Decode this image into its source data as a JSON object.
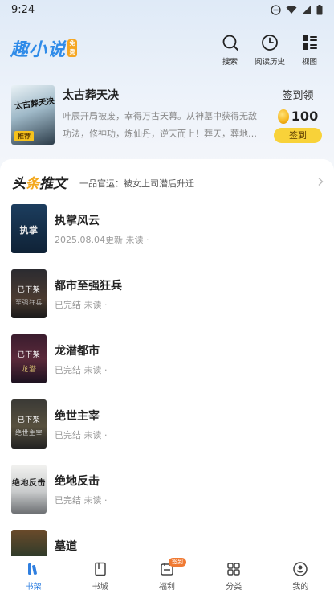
{
  "status_bar": {
    "time": "9:24"
  },
  "header": {
    "logo_text": "趣小说",
    "logo_badge": "免费",
    "actions": [
      {
        "label": "搜索",
        "icon": "search-icon"
      },
      {
        "label": "阅读历史",
        "icon": "clock-icon"
      },
      {
        "label": "视图",
        "icon": "grid-view-icon"
      }
    ]
  },
  "featured": {
    "title": "太古葬天决",
    "cover_title": "太古葬天决",
    "badge": "推荐",
    "description": "叶辰开局被废，幸得万古天幕。从神墓中获得无敌功法，修神功，炼仙丹，逆天而上！葬天，葬地…"
  },
  "signin": {
    "label": "签到领",
    "coins": "100",
    "button": "签到"
  },
  "headline": {
    "title_pre": "头",
    "title_accent": "条",
    "title_post": "推文",
    "subtitle": "一品官运：被女上司潜后升迁"
  },
  "books": [
    {
      "title": "执掌风云",
      "meta": "2025.08.04更新 未读 ·",
      "cover_label": "",
      "cover_text": "执掌"
    },
    {
      "title": "都市至强狂兵",
      "meta": "已完结 未读 ·",
      "cover_label": "已下架",
      "cover_text": "至强狂兵"
    },
    {
      "title": "龙潜都市",
      "meta": "已完结 未读 ·",
      "cover_label": "已下架",
      "cover_text": "龙潜"
    },
    {
      "title": "绝世主宰",
      "meta": "已完结 未读 ·",
      "cover_label": "已下架",
      "cover_text": "绝世主宰"
    },
    {
      "title": "绝地反击",
      "meta": "已完结 未读 ·",
      "cover_label": "",
      "cover_text": "绝地反击"
    },
    {
      "title": "墓道",
      "meta": "",
      "cover_label": "",
      "cover_text": ""
    }
  ],
  "tabbar": {
    "tabs": [
      {
        "label": "书架",
        "icon": "bookshelf-icon",
        "active": true
      },
      {
        "label": "书城",
        "icon": "book-icon",
        "active": false
      },
      {
        "label": "福利",
        "icon": "calendar-gift-icon",
        "active": false,
        "badge": "签到"
      },
      {
        "label": "分类",
        "icon": "category-grid-icon",
        "active": false
      },
      {
        "label": "我的",
        "icon": "profile-icon",
        "active": false
      }
    ]
  },
  "colors": {
    "accent_blue": "#2f7fe0",
    "gold": "#f8d239",
    "headline_accent": "#f3a71b"
  }
}
